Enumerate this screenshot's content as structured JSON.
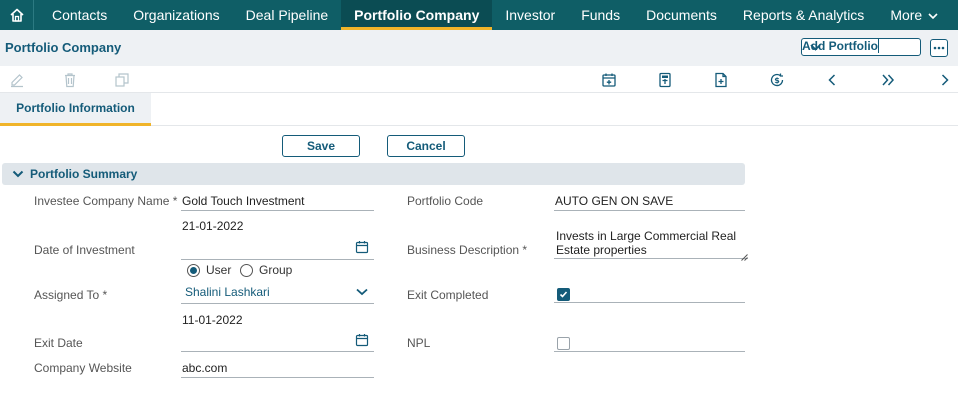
{
  "nav": {
    "items": [
      {
        "label": "Contacts"
      },
      {
        "label": "Organizations"
      },
      {
        "label": "Deal Pipeline"
      },
      {
        "label": "Portfolio Company",
        "active": true
      },
      {
        "label": "Investor"
      },
      {
        "label": "Funds"
      },
      {
        "label": "Documents"
      },
      {
        "label": "Reports & Analytics"
      },
      {
        "label": "More"
      }
    ]
  },
  "header": {
    "title": "Portfolio Company",
    "add_button": "Add Portfolio"
  },
  "tabs": [
    {
      "label": "Portfolio Information"
    }
  ],
  "actions": {
    "save": "Save",
    "cancel": "Cancel"
  },
  "section": {
    "title": "Portfolio Summary"
  },
  "form": {
    "investee_company_name": {
      "label": "Investee Company Name *",
      "value": "Gold Touch Investment"
    },
    "date_of_investment": {
      "label": "Date of Investment",
      "value": "21-01-2022"
    },
    "assigned_to": {
      "label": "Assigned To *",
      "options": [
        "User",
        "Group"
      ],
      "selected_option": "User",
      "value": "Shalini Lashkari"
    },
    "exit_date": {
      "label": "Exit Date",
      "value": "11-01-2022"
    },
    "company_website": {
      "label": "Company Website",
      "value": "abc.com"
    },
    "portfolio_code": {
      "label": "Portfolio Code",
      "value": "AUTO GEN ON SAVE"
    },
    "business_description": {
      "label": "Business Description *",
      "value": "Invests in Large Commercial Real Estate properties"
    },
    "exit_completed": {
      "label": "Exit Completed",
      "checked": true
    },
    "npl": {
      "label": "NPL",
      "checked": false
    }
  },
  "colors": {
    "nav_bg": "#0f5e66",
    "accent": "#f0b42a",
    "primary": "#145b79"
  }
}
